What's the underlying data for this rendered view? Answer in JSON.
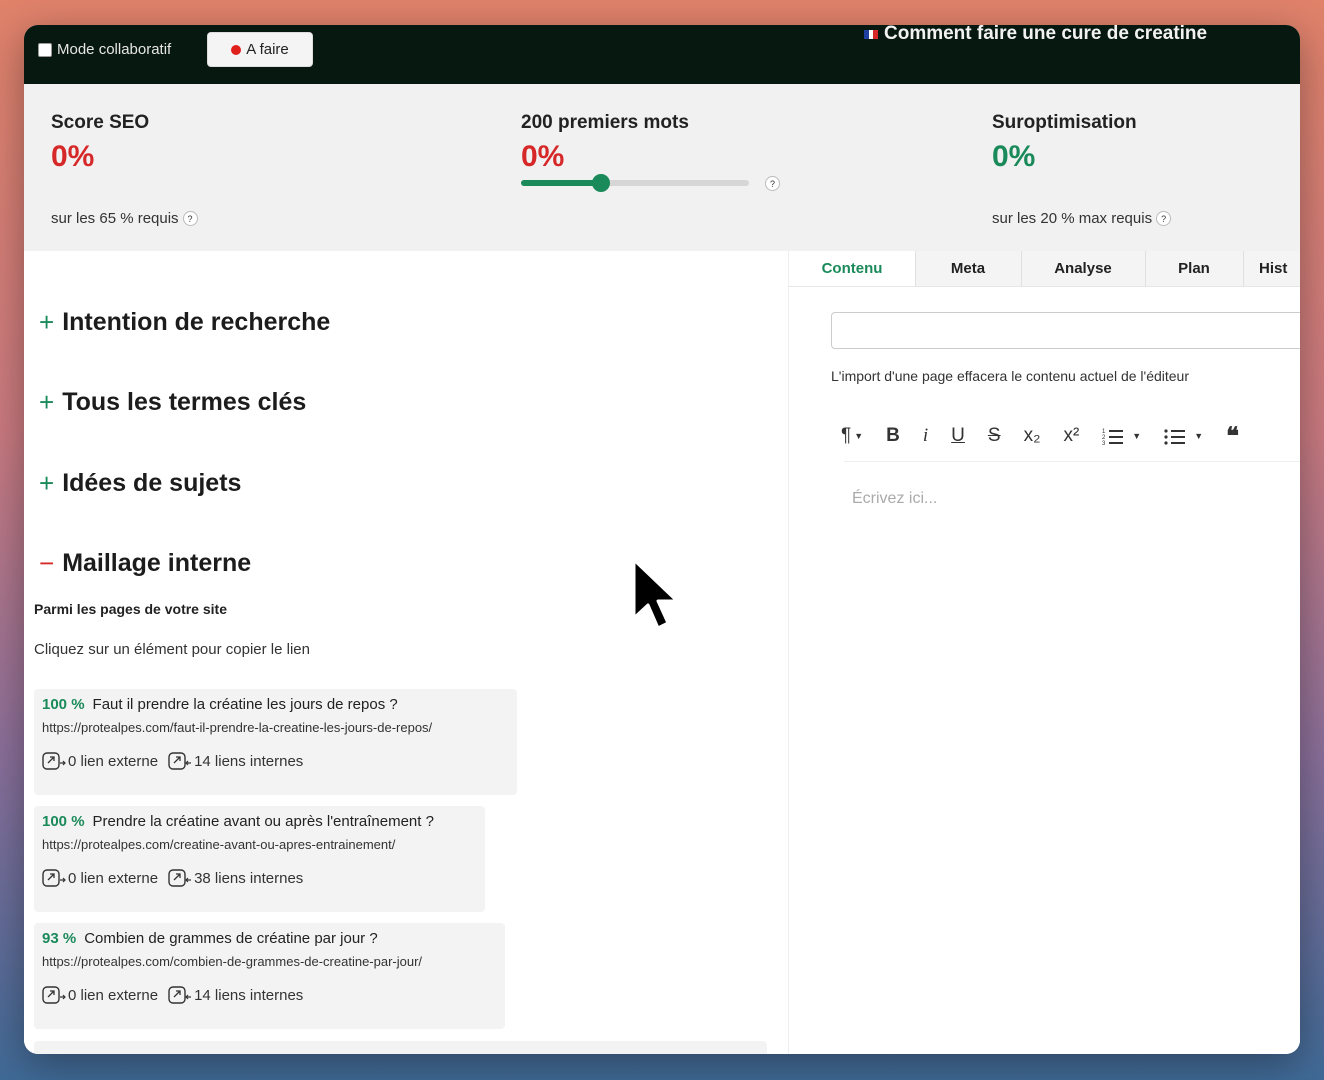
{
  "topbar": {
    "collab_label": "Mode collaboratif",
    "status_label": "A faire",
    "status_color": "#e0201b",
    "doc_title": "Comment faire une cure de creatine",
    "flag_icon": "flag-fr-icon"
  },
  "scores": {
    "seo": {
      "label": "Score SEO",
      "value": "0%",
      "sub": "sur les 65 % requis",
      "value_color": "#d62828"
    },
    "first_words": {
      "label": "200 premiers mots",
      "value": "0%",
      "value_color": "#d62828",
      "slider_fraction": 0.35
    },
    "overopt": {
      "label": "Suroptimisation",
      "value": "0%",
      "sub": "sur les 20 % max requis",
      "value_color": "#1a8a5a"
    },
    "help": "?"
  },
  "sections": {
    "intention": "Intention de recherche",
    "terms": "Tous les termes clés",
    "ideas": "Idées de sujets",
    "linking": "Maillage interne"
  },
  "linking": {
    "subhead": "Parmi les pages de votre site",
    "hint": "Cliquez sur un élément pour copier le lien",
    "items": [
      {
        "pct": "100 %",
        "title": "Faut il prendre la créatine les jours de repos ?",
        "url": "https://protealpes.com/faut-il-prendre-la-creatine-les-jours-de-repos/",
        "external": "0 lien externe",
        "internal": "14 liens internes"
      },
      {
        "pct": "100 %",
        "title": "Prendre la créatine avant ou après l'entraînement ?",
        "url": "https://protealpes.com/creatine-avant-ou-apres-entrainement/",
        "external": "0 lien externe",
        "internal": "38 liens internes"
      },
      {
        "pct": "93 %",
        "title": "Combien de grammes de créatine par jour ?",
        "url": "https://protealpes.com/combien-de-grammes-de-creatine-par-jour/",
        "external": "0 lien externe",
        "internal": "14 liens internes"
      }
    ]
  },
  "tabs": [
    "Contenu",
    "Meta",
    "Analyse",
    "Plan",
    "Hist"
  ],
  "editor": {
    "import_note": "L'import d'une page effacera le contenu actuel de l'éditeur",
    "placeholder": "Écrivez ici...",
    "toolbar": [
      "¶",
      "B",
      "i",
      "U",
      "S",
      "x₂",
      "x²",
      "ordered-list",
      "bullet-list",
      "quote"
    ]
  },
  "accent": "#1a8a5a"
}
